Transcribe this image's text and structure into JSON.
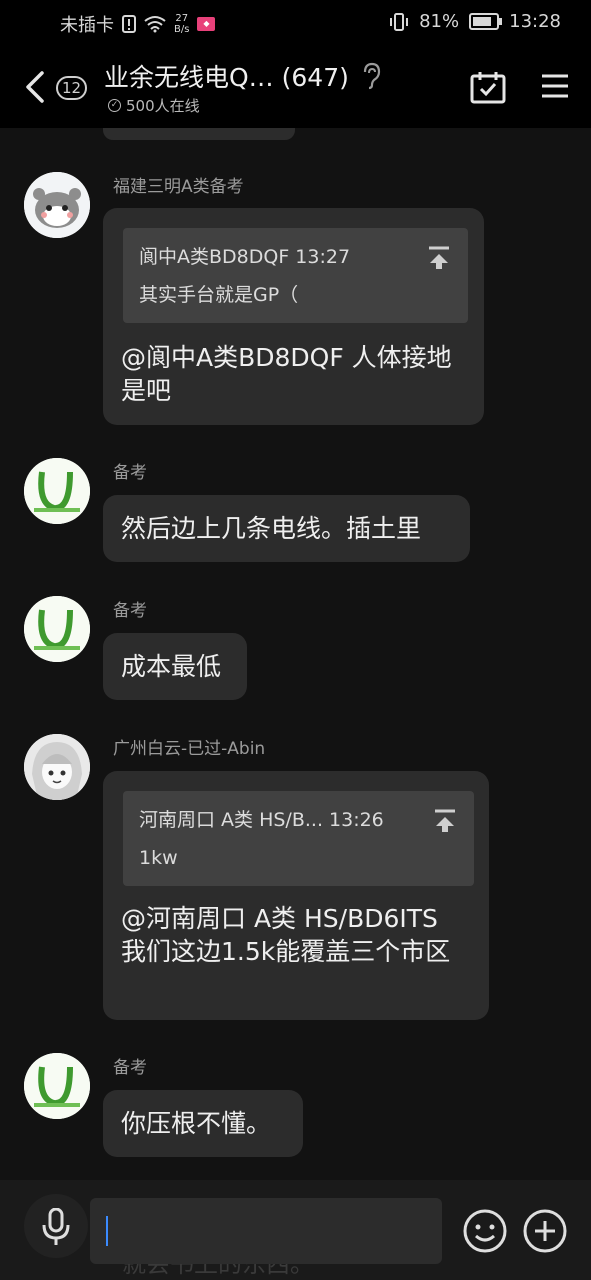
{
  "status_bar": {
    "carrier": "未插卡",
    "net_speed_value": "27",
    "net_speed_unit": "B/s",
    "battery": "81%",
    "time": "13:28"
  },
  "header": {
    "unread_count": "12",
    "group_name": "业余无线电Q…",
    "member_count": "(647)",
    "online_text": "500人在线"
  },
  "messages": [
    {
      "sender": "福建三明A类备考",
      "quote": {
        "author_time": "阆中A类BD8DQF 13:27",
        "text": "其实手台就是GP（"
      },
      "text": "@阆中A类BD8DQF 人体接地是吧"
    },
    {
      "sender": "备考",
      "text": "然后边上几条电线。插土里"
    },
    {
      "sender": "备考",
      "text": "成本最低"
    },
    {
      "sender": "广州白云-已过-Abin",
      "quote": {
        "author_time": "河南周口 A类 HS/B... 13:26",
        "text": "1kw"
      },
      "text": "@河南周口 A类 HS/BD6ITS 我们这边1.5k能覆盖三个市区"
    },
    {
      "sender": "备考",
      "text": "你压根不懂。"
    }
  ],
  "input": {
    "ghost_text": "就会书上的东西。",
    "value": ""
  },
  "colors": {
    "background": "#121212",
    "bubble": "#2c2c2c",
    "quote": "#414141",
    "caret": "#3b8bff"
  }
}
